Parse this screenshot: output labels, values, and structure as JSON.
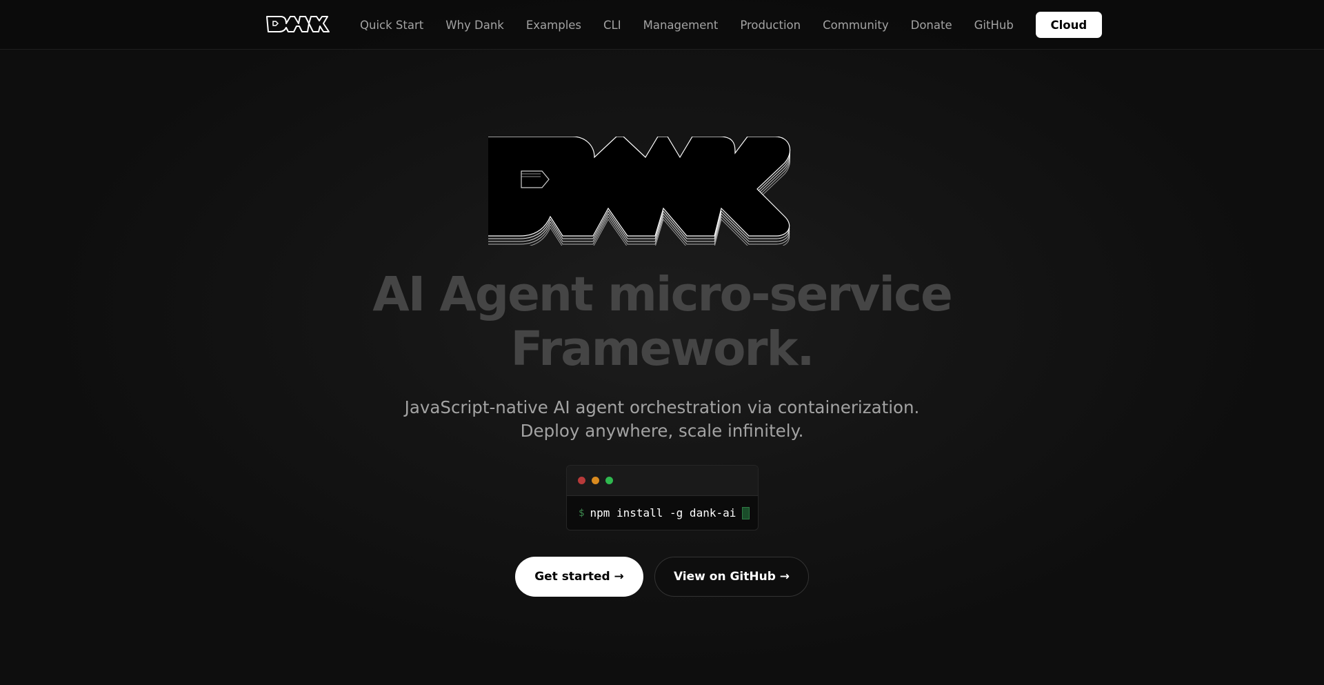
{
  "brand": {
    "logo_text": "DANK"
  },
  "nav": {
    "links": [
      "Quick Start",
      "Why Dank",
      "Examples",
      "CLI",
      "Management",
      "Production",
      "Community",
      "Donate",
      "GitHub"
    ],
    "cloud_label": "Cloud"
  },
  "hero": {
    "headline_line1": "AI Agent micro-service",
    "headline_line2": "Framework.",
    "subhead_line1": "JavaScript-native AI agent orchestration via containerization.",
    "subhead_line2": "Deploy anywhere, scale infinitely."
  },
  "terminal": {
    "prompt": "$",
    "command": "npm install -g dank-ai",
    "dot_colors": [
      "#b83a3a",
      "#d98a1f",
      "#2fb84f"
    ]
  },
  "cta": {
    "primary_label": "Get started →",
    "secondary_label": "View on GitHub →"
  },
  "icons": {
    "brand_logo": "dank-wordmark-logo",
    "hero_logo": "dank-wordmark-hero-logo"
  }
}
